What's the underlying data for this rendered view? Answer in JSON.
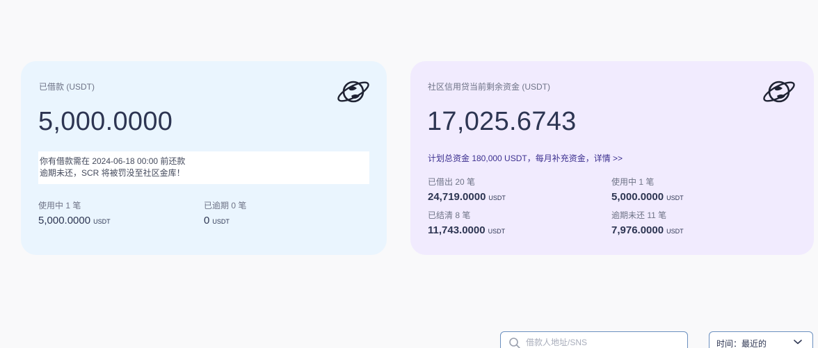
{
  "borrowed_card": {
    "label": "已借款 (USDT)",
    "amount": "5,000.0000",
    "icon": "planet-icon",
    "notice_line1": "你有借款需在 2024-06-18 00:00 前还款",
    "notice_line2": "逾期未还，SCR 将被罚没至社区金库！",
    "in_use_label": "使用中 1 笔",
    "in_use_value": "5,000.0000",
    "in_use_unit": "USDT",
    "overdue_label": "已逾期 0 笔",
    "overdue_value": "0",
    "overdue_unit": "USDT"
  },
  "community_card": {
    "label": "社区信用贷当前剩余资金 (USDT)",
    "amount": "17,025.6743",
    "icon": "planet-icon",
    "plan_text": "计划总资金 180,000 USDT，每月补充资金，",
    "plan_link": "详情 >>",
    "stats": [
      {
        "label": "已借出 20 笔",
        "value": "24,719.0000",
        "unit": "USDT"
      },
      {
        "label": "使用中 1 笔",
        "value": "5,000.0000",
        "unit": "USDT"
      },
      {
        "label": "已结清 8 笔",
        "value": "11,743.0000",
        "unit": "USDT"
      },
      {
        "label": "逾期未还 11 笔",
        "value": "7,976.0000",
        "unit": "USDT"
      }
    ]
  },
  "filters": {
    "search_placeholder": "借款人地址/SNS",
    "time_label": "时间：最近的"
  },
  "colors": {
    "left_card_bg": "#eaf5fe",
    "right_card_bg": "#f1ebfe",
    "text_dark": "#2d3552",
    "link": "#3b2f8f"
  }
}
